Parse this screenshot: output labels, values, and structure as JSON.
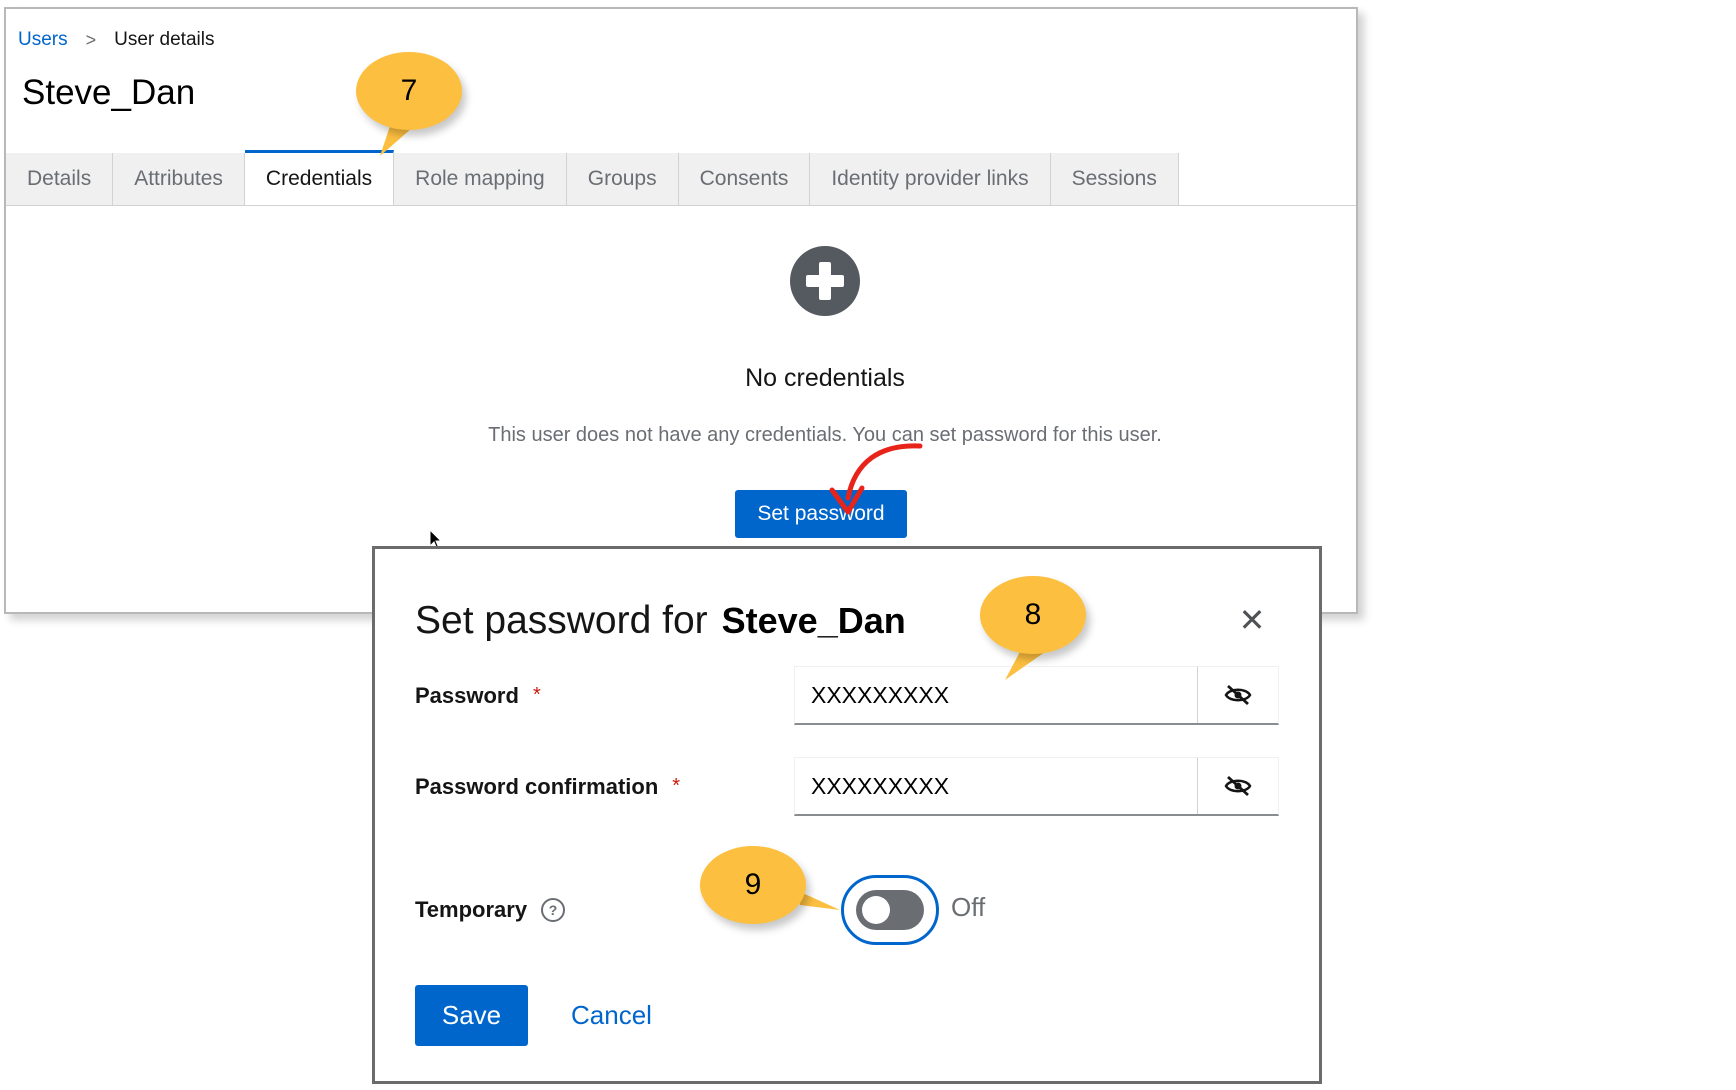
{
  "breadcrumb": {
    "link": "Users",
    "separator": ">",
    "current": "User details"
  },
  "page": {
    "title": "Steve_Dan"
  },
  "tabs": [
    {
      "label": "Details",
      "active": false
    },
    {
      "label": "Attributes",
      "active": false
    },
    {
      "label": "Credentials",
      "active": true
    },
    {
      "label": "Role mapping",
      "active": false
    },
    {
      "label": "Groups",
      "active": false
    },
    {
      "label": "Consents",
      "active": false
    },
    {
      "label": "Identity provider links",
      "active": false
    },
    {
      "label": "Sessions",
      "active": false
    }
  ],
  "empty_state": {
    "icon": "plus-circle-icon",
    "title": "No credentials",
    "description": "This user does not have any credentials. You can set password for this user.",
    "button_label": "Set password"
  },
  "modal": {
    "title_prefix": "Set password for",
    "username": "Steve_Dan",
    "close_icon": "close-icon",
    "password_label": "Password",
    "password_value": "XXXXXXXXX",
    "password_confirmation_label": "Password confirmation",
    "password_confirmation_value": "XXXXXXXXX",
    "required_marker": "*",
    "temporary_label": "Temporary",
    "temporary_help_icon": "?",
    "temporary_state": "Off",
    "save_label": "Save",
    "cancel_label": "Cancel"
  },
  "callouts": {
    "step7": "7",
    "step8": "8",
    "step9": "9"
  },
  "colors": {
    "primary": "#0066cc",
    "callout": "#fdbf3f",
    "annotation_arrow": "#e8231a",
    "required": "#c9190b"
  }
}
